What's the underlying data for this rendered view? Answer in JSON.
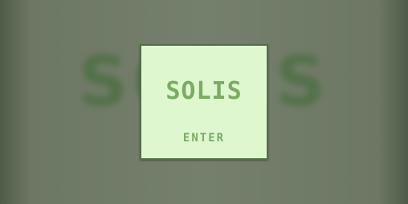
{
  "background": {
    "logo_text": "SOLIS",
    "color": "#4f6f45"
  },
  "title_panel": {
    "logo": "SOLIS",
    "enter_label": "ENTER",
    "panel_color": "#dff7cf",
    "border_color": "#4e7143",
    "text_color": "#7cab64"
  }
}
